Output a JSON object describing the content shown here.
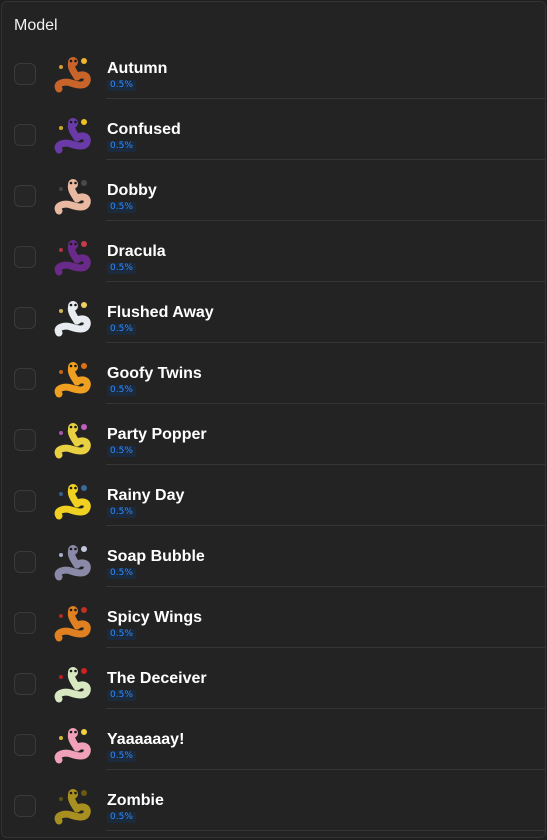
{
  "section": {
    "title": "Model"
  },
  "items": [
    {
      "name": "Autumn",
      "rate": "0.5%",
      "icon": "autumn-worm-icon",
      "color": "#c8642a",
      "accent": "#f2b431"
    },
    {
      "name": "Confused",
      "rate": "0.5%",
      "icon": "confused-worm-icon",
      "color": "#6a3aa8",
      "accent": "#f0c020"
    },
    {
      "name": "Dobby",
      "rate": "0.5%",
      "icon": "dobby-worm-icon",
      "color": "#e8b8a0",
      "accent": "#4a4a4a"
    },
    {
      "name": "Dracula",
      "rate": "0.5%",
      "icon": "dracula-worm-icon",
      "color": "#6a2a8a",
      "accent": "#c83a4a"
    },
    {
      "name": "Flushed Away",
      "rate": "0.5%",
      "icon": "flushed-away-worm-icon",
      "color": "#e8ecf0",
      "accent": "#f0d060"
    },
    {
      "name": "Goofy Twins",
      "rate": "0.5%",
      "icon": "goofy-twins-worm-icon",
      "color": "#f0a020",
      "accent": "#e07010"
    },
    {
      "name": "Party Popper",
      "rate": "0.5%",
      "icon": "party-popper-worm-icon",
      "color": "#e8d040",
      "accent": "#c060c0"
    },
    {
      "name": "Rainy Day",
      "rate": "0.5%",
      "icon": "rainy-day-worm-icon",
      "color": "#f0d020",
      "accent": "#3a6a9a"
    },
    {
      "name": "Soap Bubble",
      "rate": "0.5%",
      "icon": "soap-bubble-worm-icon",
      "color": "#8a8aa8",
      "accent": "#c0c8e0"
    },
    {
      "name": "Spicy Wings",
      "rate": "0.5%",
      "icon": "spicy-wings-worm-icon",
      "color": "#e08020",
      "accent": "#c03020"
    },
    {
      "name": "The Deceiver",
      "rate": "0.5%",
      "icon": "deceiver-worm-icon",
      "color": "#d8e8c0",
      "accent": "#d02020"
    },
    {
      "name": "Yaaaaaay!",
      "rate": "0.5%",
      "icon": "yaaaaaay-worm-icon",
      "color": "#f0a0b8",
      "accent": "#f0d040"
    },
    {
      "name": "Zombie",
      "rate": "0.5%",
      "icon": "zombie-worm-icon",
      "color": "#a89020",
      "accent": "#6a5a10"
    }
  ]
}
